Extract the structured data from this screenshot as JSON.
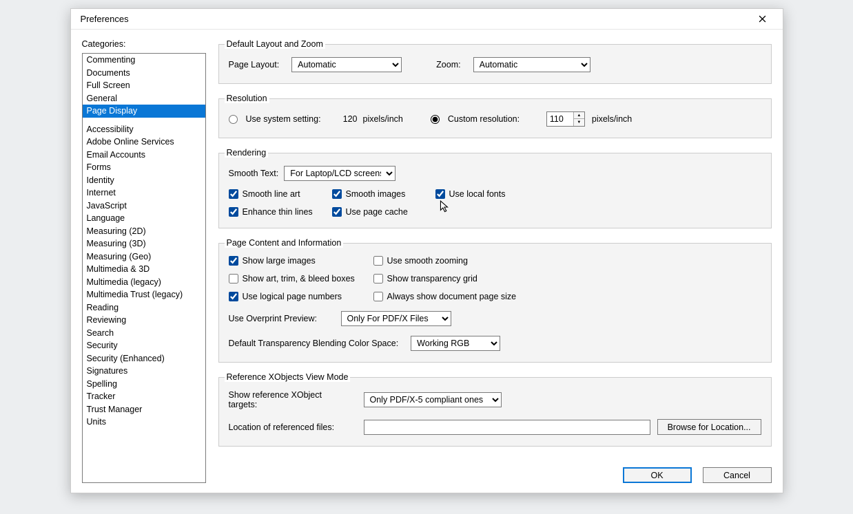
{
  "window": {
    "title": "Preferences"
  },
  "sidebar": {
    "label": "Categories:",
    "groups": [
      [
        "Commenting",
        "Documents",
        "Full Screen",
        "General",
        "Page Display"
      ],
      [
        "Accessibility",
        "Adobe Online Services",
        "Email Accounts",
        "Forms",
        "Identity",
        "Internet",
        "JavaScript",
        "Language",
        "Measuring (2D)",
        "Measuring (3D)",
        "Measuring (Geo)",
        "Multimedia & 3D",
        "Multimedia (legacy)",
        "Multimedia Trust (legacy)",
        "Reading",
        "Reviewing",
        "Search",
        "Security",
        "Security (Enhanced)",
        "Signatures",
        "Spelling",
        "Tracker",
        "Trust Manager",
        "Units"
      ]
    ],
    "selected": "Page Display"
  },
  "layout": {
    "legend": "Default Layout and Zoom",
    "pageLayoutLabel": "Page Layout:",
    "pageLayoutValue": "Automatic",
    "zoomLabel": "Zoom:",
    "zoomValue": "Automatic"
  },
  "resolution": {
    "legend": "Resolution",
    "systemLabel": "Use system setting:",
    "systemValue": "120",
    "unit": "pixels/inch",
    "customLabel": "Custom resolution:",
    "customValue": "110",
    "selected": "custom"
  },
  "rendering": {
    "legend": "Rendering",
    "smoothTextLabel": "Smooth Text:",
    "smoothTextValue": "For Laptop/LCD screens",
    "checks": {
      "smoothLineArt": {
        "label": "Smooth line art",
        "checked": true
      },
      "smoothImages": {
        "label": "Smooth images",
        "checked": true
      },
      "useLocalFonts": {
        "label": "Use local fonts",
        "checked": true
      },
      "enhanceThinLines": {
        "label": "Enhance thin lines",
        "checked": true
      },
      "usePageCache": {
        "label": "Use page cache",
        "checked": true
      }
    }
  },
  "content": {
    "legend": "Page Content and Information",
    "checks": {
      "showLargeImages": {
        "label": "Show large images",
        "checked": true
      },
      "useSmoothZooming": {
        "label": "Use smooth zooming",
        "checked": false
      },
      "showArtTrim": {
        "label": "Show art, trim, & bleed boxes",
        "checked": false
      },
      "showTransparencyGrid": {
        "label": "Show transparency grid",
        "checked": false
      },
      "useLogicalPageNumbers": {
        "label": "Use logical page numbers",
        "checked": true
      },
      "alwaysShowDocSize": {
        "label": "Always show document page size",
        "checked": false
      }
    },
    "overprintLabel": "Use Overprint Preview:",
    "overprintValue": "Only For PDF/X Files",
    "blendingLabel": "Default Transparency Blending Color Space:",
    "blendingValue": "Working RGB"
  },
  "xobjects": {
    "legend": "Reference XObjects View Mode",
    "showLabel": "Show reference XObject targets:",
    "showValue": "Only PDF/X-5 compliant ones",
    "locationLabel": "Location of referenced files:",
    "locationValue": "",
    "browseLabel": "Browse for Location..."
  },
  "footer": {
    "ok": "OK",
    "cancel": "Cancel"
  }
}
